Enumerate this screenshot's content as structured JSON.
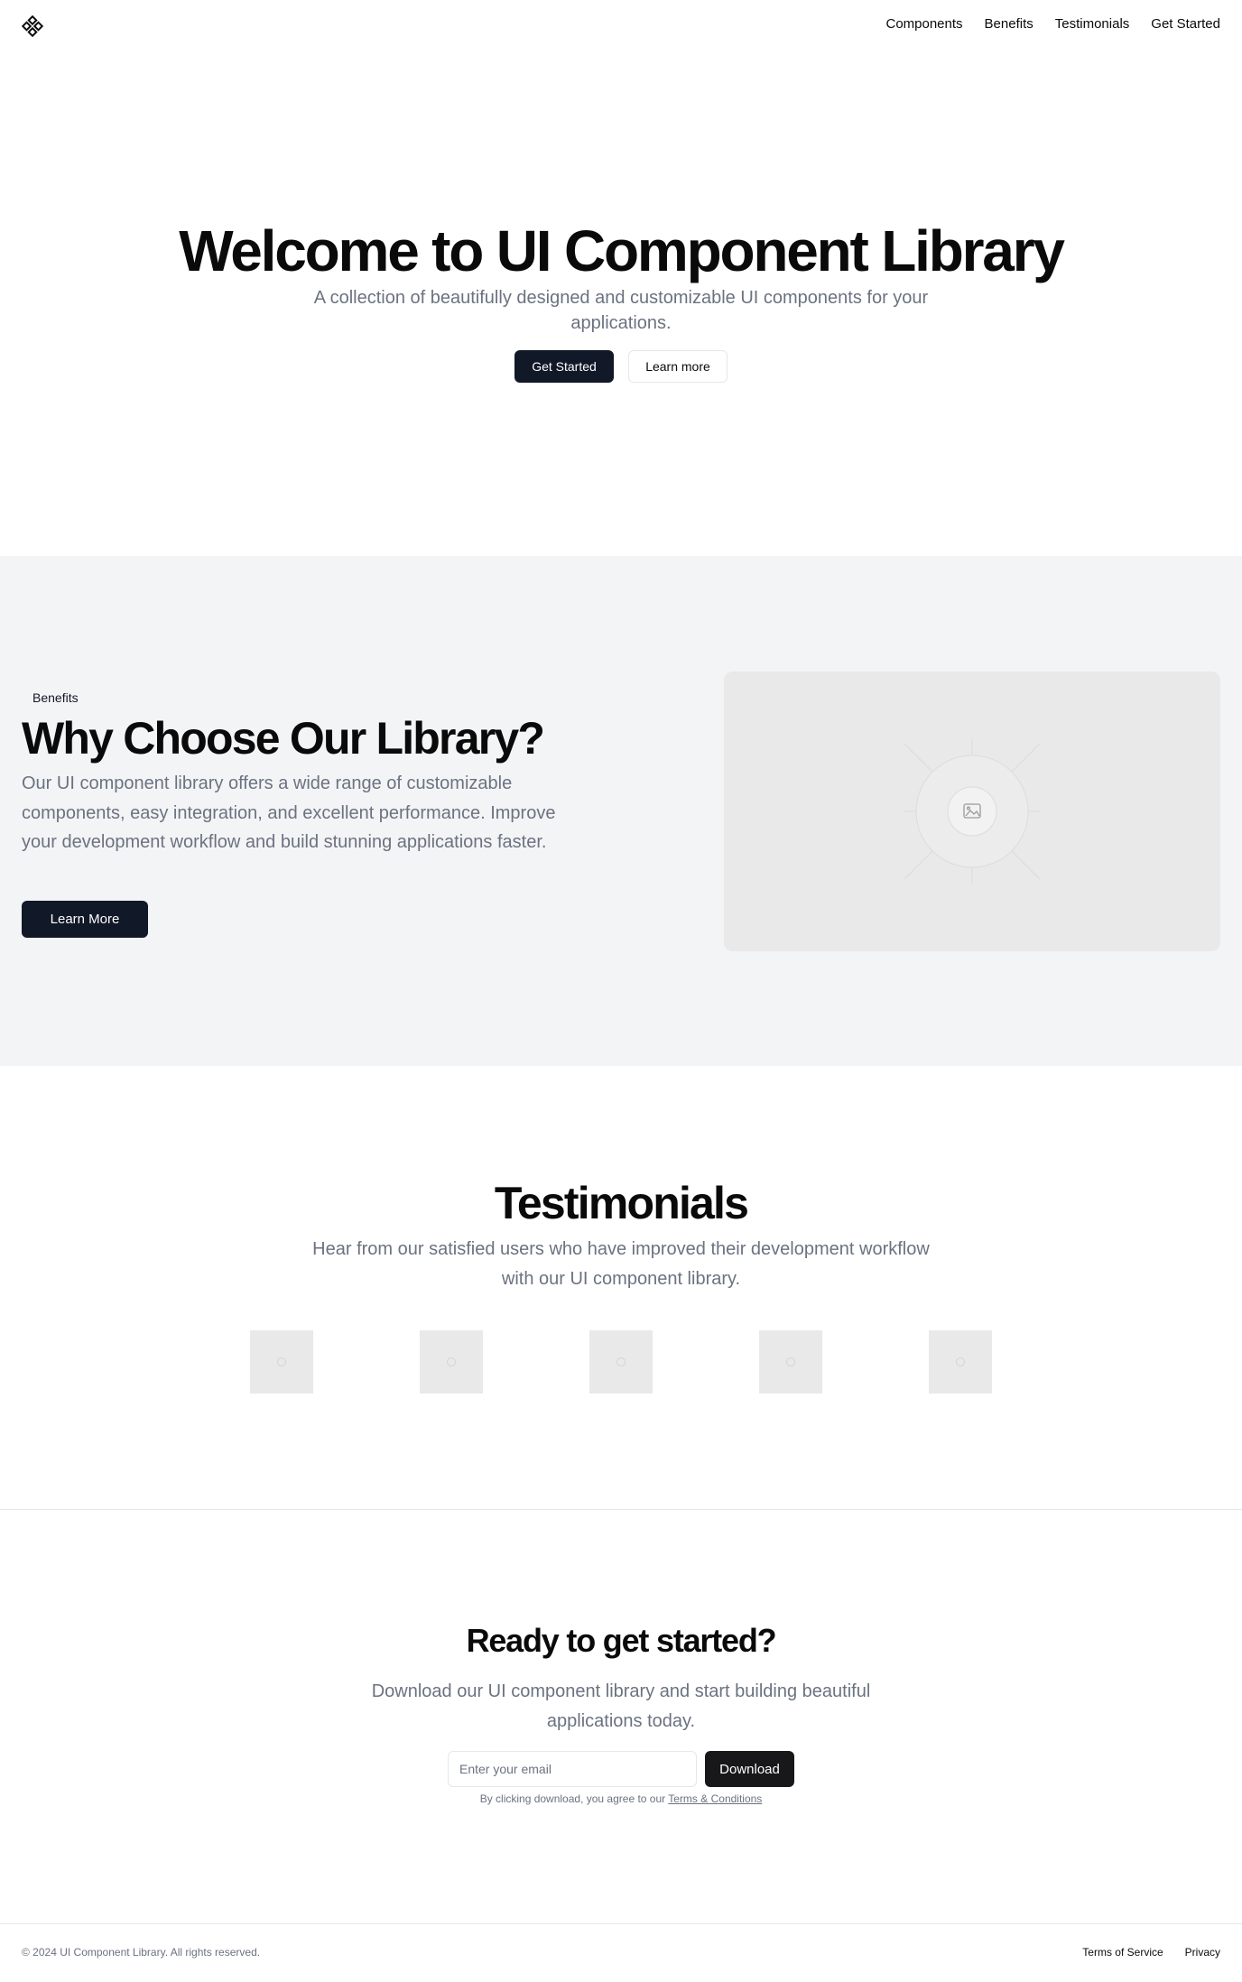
{
  "nav": {
    "logo_icon": "diamond-grid-logo-icon",
    "links": [
      "Components",
      "Benefits",
      "Testimonials",
      "Get Started"
    ]
  },
  "hero": {
    "title": "Welcome to UI Component Library",
    "subtitle": "A collection of beautifully designed and customizable UI components for your applications.",
    "primary_button": "Get Started",
    "secondary_button": "Learn more"
  },
  "benefits": {
    "badge": "Benefits",
    "title": "Why Choose Our Library?",
    "text": "Our UI component library offers a wide range of customizable components, easy integration, and excellent performance. Improve your development workflow and build stunning applications faster.",
    "button": "Learn More",
    "media_icon": "image-placeholder-icon"
  },
  "testimonials": {
    "title": "Testimonials",
    "subtitle": "Hear from our satisfied users who have improved their development workflow with our UI component library.",
    "placeholder_icon": "image-placeholder-icon",
    "thumbnail_count": 5
  },
  "cta": {
    "title": "Ready to get started?",
    "subtitle": "Download our UI component library and start building beautiful applications today.",
    "email_placeholder": "Enter your email",
    "email_value": "",
    "button": "Download",
    "terms_prefix": "By clicking download, you agree to our",
    "terms_link": "Terms & Conditions"
  },
  "footer": {
    "copyright": "© 2024 UI Component Library. All rights reserved.",
    "links": [
      "Terms of Service",
      "Privacy"
    ]
  },
  "colors": {
    "primary_dark": "#111827",
    "muted_text": "#6b7280",
    "section_bg": "#f3f4f6",
    "placeholder_bg": "#e9e9e9"
  }
}
